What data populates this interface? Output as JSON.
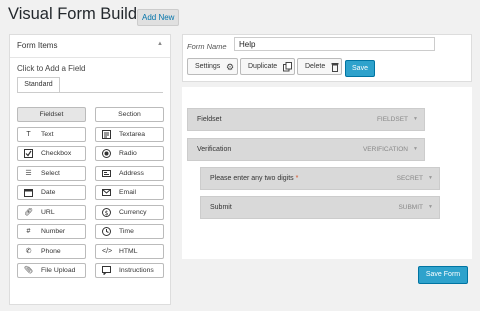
{
  "header": {
    "title": "Visual Form Builder",
    "add_new": "Add New"
  },
  "form_items": {
    "title": "Form Items",
    "click_prefix": "Click",
    "click_rest": "to Add a Field",
    "tab": "Standard",
    "buttons": [
      {
        "label": "Fieldset",
        "icon": ""
      },
      {
        "label": "Section",
        "icon": ""
      },
      {
        "label": "Text",
        "icon": "text-icon"
      },
      {
        "label": "Textarea",
        "icon": "textarea-icon"
      },
      {
        "label": "Checkbox",
        "icon": "checkbox-icon"
      },
      {
        "label": "Radio",
        "icon": "radio-icon"
      },
      {
        "label": "Select",
        "icon": "select-icon"
      },
      {
        "label": "Address",
        "icon": "address-icon"
      },
      {
        "label": "Date",
        "icon": "calendar-icon"
      },
      {
        "label": "Email",
        "icon": "email-icon"
      },
      {
        "label": "URL",
        "icon": "link-icon"
      },
      {
        "label": "Currency",
        "icon": "currency-icon"
      },
      {
        "label": "Number",
        "icon": "number-icon"
      },
      {
        "label": "Time",
        "icon": "clock-icon"
      },
      {
        "label": "Phone",
        "icon": "phone-icon"
      },
      {
        "label": "HTML",
        "icon": "code-icon"
      },
      {
        "label": "File Upload",
        "icon": "paperclip-icon"
      },
      {
        "label": "Instructions",
        "icon": "instructions-icon"
      }
    ]
  },
  "form": {
    "name_label": "Form Name",
    "name_value": "Help",
    "settings": "Settings",
    "duplicate": "Duplicate",
    "delete": "Delete",
    "save": "Save",
    "save_form": "Save Form"
  },
  "fields": [
    {
      "label": "Fieldset",
      "type": "FIELDSET",
      "required": ""
    },
    {
      "label": "Verification",
      "type": "VERIFICATION",
      "required": ""
    },
    {
      "label": "Please enter any two digits",
      "type": "SECRET",
      "required": "*"
    },
    {
      "label": "Submit",
      "type": "SUBMIT",
      "required": ""
    }
  ]
}
